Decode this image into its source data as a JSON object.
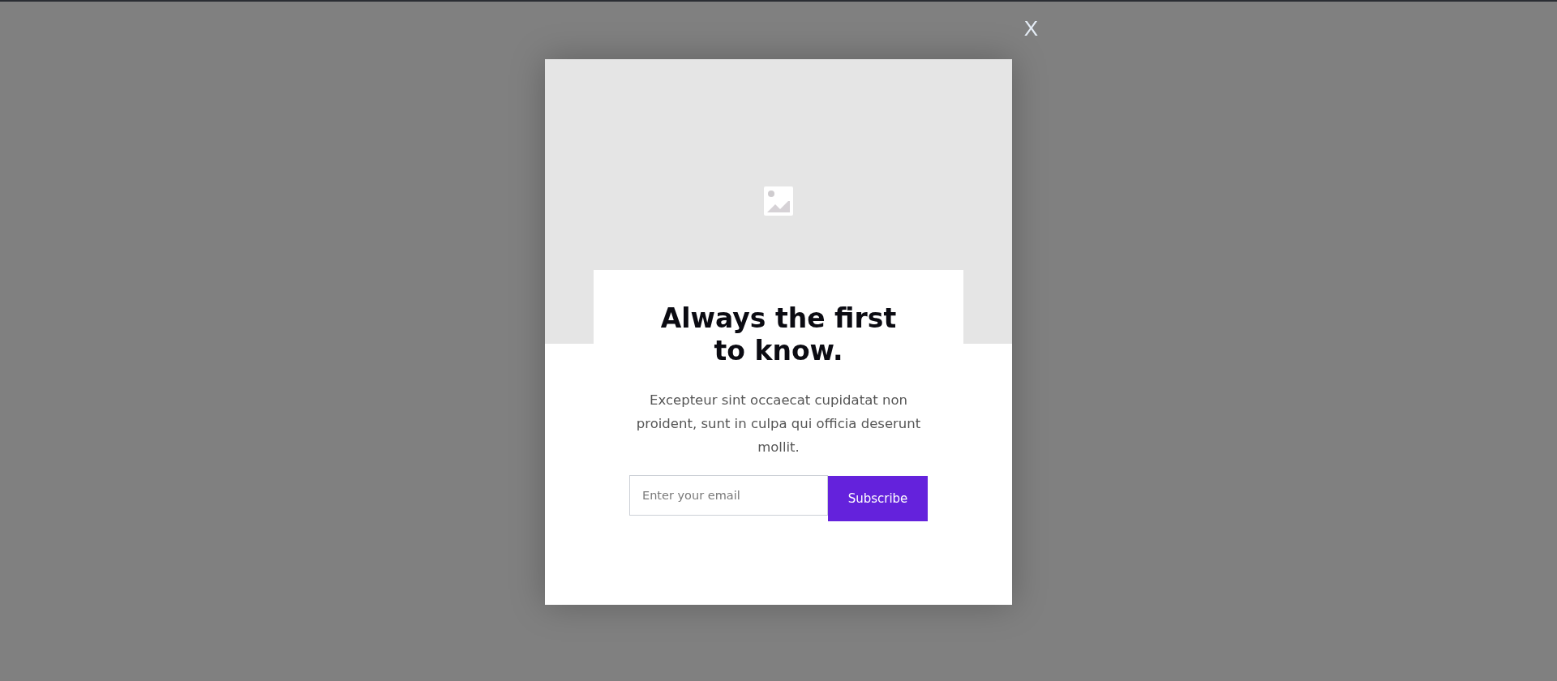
{
  "close_button": {
    "label": "X"
  },
  "popup": {
    "title": "Always the first to know.",
    "text": "Excepteur sint occaecat cupidatat non proident, sunt in culpa qui officia deserunt mollit.",
    "email_field": {
      "placeholder": "Enter your email"
    },
    "subscribe_button": {
      "label": "Subscribe"
    }
  }
}
